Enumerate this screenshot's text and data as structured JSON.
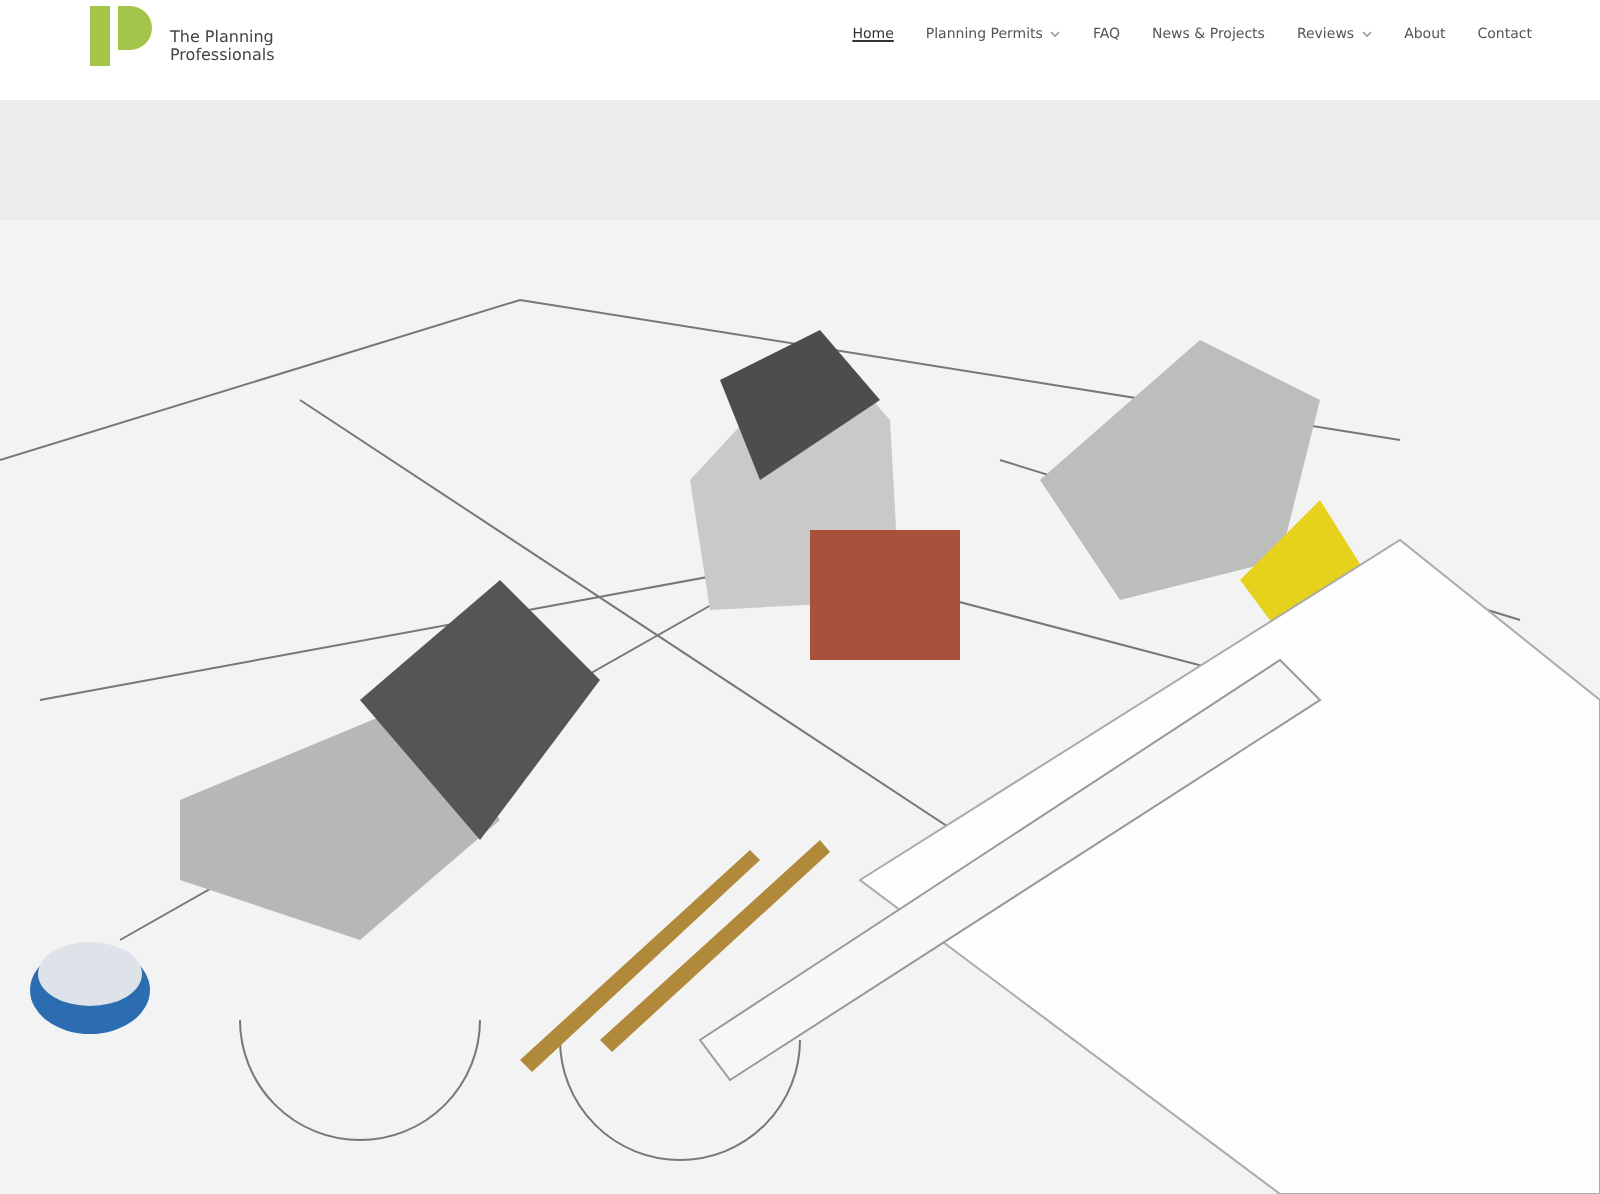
{
  "logo": {
    "text_lines": [
      "The Planning",
      "Professionals"
    ]
  },
  "nav": [
    {
      "label": "Home",
      "selected": true,
      "has_dropdown": false
    },
    {
      "label": "Planning Permits",
      "selected": false,
      "has_dropdown": true
    },
    {
      "label": "FAQ",
      "selected": false,
      "has_dropdown": false
    },
    {
      "label": "News & Projects",
      "selected": false,
      "has_dropdown": false
    },
    {
      "label": "Reviews",
      "selected": false,
      "has_dropdown": true
    },
    {
      "label": "About",
      "selected": false,
      "has_dropdown": false
    },
    {
      "label": "Contact",
      "selected": false,
      "has_dropdown": false
    }
  ]
}
